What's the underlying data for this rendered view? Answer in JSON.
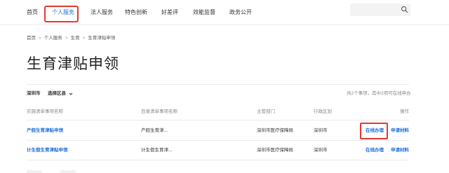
{
  "nav": {
    "items": [
      {
        "label": "首页"
      },
      {
        "label": "个人服务"
      },
      {
        "label": "法人服务"
      },
      {
        "label": "特色创新"
      },
      {
        "label": "好差评"
      },
      {
        "label": "效能监督"
      },
      {
        "label": "政务公开"
      }
    ],
    "active_index": 1,
    "search_placeholder": ""
  },
  "breadcrumb": [
    "首页",
    "个人服务",
    "生育",
    "生育津贴申领"
  ],
  "page_title": "生育津贴申领",
  "filter": {
    "city": "深圳市",
    "district_label": "选择区县",
    "summary": "共2个事项，其中2项可在线申办"
  },
  "table": {
    "headers": [
      "实施清单事项名称",
      "目录清单事项名称",
      "主管部门",
      "行政区划",
      "操作"
    ],
    "rows": [
      {
        "name": "产假生育津贴申领",
        "catalog": "产假生育津...",
        "dept": "深圳市医疗保障局",
        "region": "深圳市",
        "action_online": "在线办理",
        "action_material": "申请材料"
      },
      {
        "name": "计生假生育津贴申领",
        "catalog": "计生假生育津...",
        "dept": "深圳市医疗保障局",
        "region": "深圳市",
        "action_online": "在线办理",
        "action_material": "申请材料"
      }
    ]
  },
  "colors": {
    "accent": "#1e6fd9",
    "highlight": "#e23a2d"
  }
}
